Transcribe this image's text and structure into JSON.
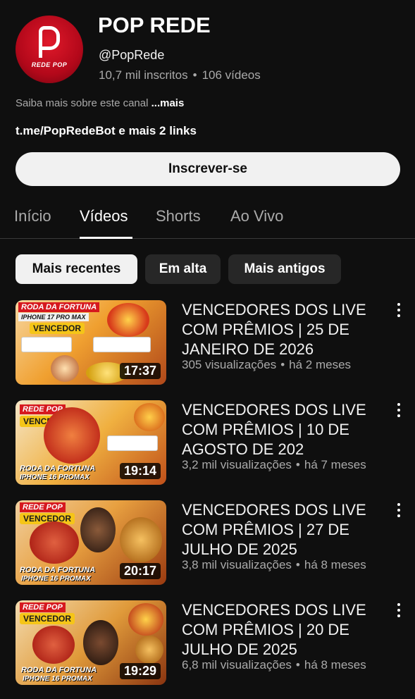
{
  "channel": {
    "title": "POP REDE",
    "handle": "@PopRede",
    "subscribers": "10,7 mil inscritos",
    "videos_count": "106 vídeos",
    "avatar_text": "REDE POP",
    "about": "Saiba mais sobre este canal",
    "about_more": "...mais",
    "links": "t.me/PopRedeBot e mais 2 links",
    "subscribe_label": "Inscrever-se"
  },
  "tabs": [
    {
      "label": "Início"
    },
    {
      "label": "Vídeos",
      "active": true
    },
    {
      "label": "Shorts"
    },
    {
      "label": "Ao Vivo"
    }
  ],
  "chips": [
    {
      "label": "Mais recentes",
      "active": true
    },
    {
      "label": "Em alta"
    },
    {
      "label": "Mais antigos"
    }
  ],
  "videos": [
    {
      "title": "VENCEDORES DOS LIVE COM PRÊMIOS | 25 DE JANEIRO DE 2026",
      "views": "305 visualizações",
      "age": "há 2 meses",
      "duration": "17:37",
      "thumb_top": "RODA DA FORTUNA",
      "thumb_sub": "IPHONE 17 PRO MAX",
      "thumb_badge": "VENCEDOR"
    },
    {
      "title": "VENCEDORES DOS LIVE COM PRÊMIOS | 10 DE AGOSTO DE 202",
      "views": "3,2 mil visualizações",
      "age": "há 7 meses",
      "duration": "19:14",
      "thumb_top": "REDE POP",
      "thumb_badge": "VENCEDOR",
      "thumb_footer1": "RODA DA FORTUNA",
      "thumb_footer2": "IPHONE 16 PROMAX"
    },
    {
      "title": "VENCEDORES DOS LIVE COM PRÊMIOS | 27 DE JULHO DE 2025",
      "views": "3,8 mil visualizações",
      "age": "há 8 meses",
      "duration": "20:17",
      "thumb_top": "REDE POP",
      "thumb_badge": "VENCEDOR",
      "thumb_footer1": "RODA DA FORTUNA",
      "thumb_footer2": "IPHONE 16 PROMAX"
    },
    {
      "title": "VENCEDORES DOS LIVE COM PRÊMIOS | 20 DE JULHO DE 2025",
      "views": "6,8 mil visualizações",
      "age": "há 8 meses",
      "duration": "19:29",
      "thumb_top": "REDE POP",
      "thumb_badge": "VENCEDOR",
      "thumb_footer1": "RODA DA FORTUNA",
      "thumb_footer2": "IPHONE 16 PROMAX"
    }
  ],
  "colors": {
    "background": "#0f0f0f",
    "text_secondary": "#aaaaaa",
    "chip_bg": "#272727",
    "avatar_red": "#e0192a"
  }
}
